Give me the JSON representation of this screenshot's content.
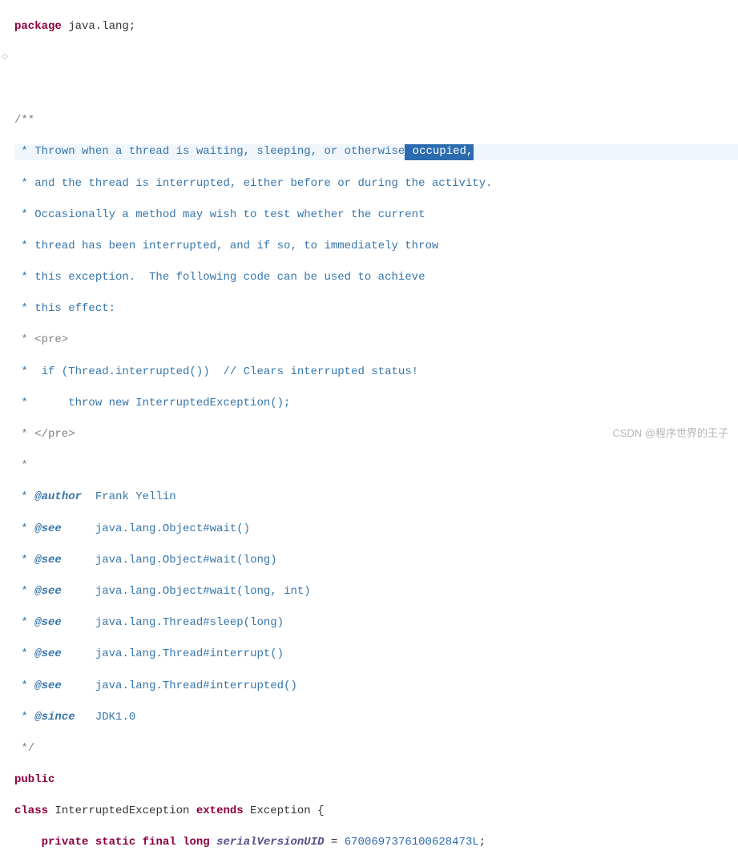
{
  "code": {
    "package_kw": "package",
    "package_name": " java.lang;",
    "doc_open": "/**",
    "doc_line1_prefix": " * Thrown when a thread is waiting, sleeping, or otherwise",
    "doc_line1_sel": " occupied,",
    "doc_line2": " * and the thread is interrupted, either before or during the activity.",
    "doc_line3": " * Occasionally a method may wish to test whether the current",
    "doc_line4": " * thread has been interrupted, and if so, to immediately throw",
    "doc_line5": " * this exception.  The following code can be used to achieve",
    "doc_line6": " * this effect:",
    "doc_line7": " * <pre>",
    "doc_line8": " *  if (Thread.interrupted())  // Clears interrupted status!",
    "doc_line9": " *      throw new InterruptedException();",
    "doc_line10": " * </pre>",
    "doc_line11": " *",
    "tag_author": "@author",
    "author_val": "  Frank Yellin",
    "tag_see": "@see",
    "see1": "     java.lang.Object#wait()",
    "see2": "     java.lang.Object#wait(long)",
    "see3": "     java.lang.Object#wait(long, int)",
    "see4": "     java.lang.Thread#sleep(long)",
    "see5": "     java.lang.Thread#interrupt()",
    "see6": "     java.lang.Thread#interrupted()",
    "tag_since": "@since",
    "since_val": "   JDK1.0",
    "doc_close": " */",
    "kw_public": "public",
    "kw_class": "class",
    "class_name": " InterruptedException ",
    "kw_extends": "extends",
    "extends_name": " Exception {",
    "kw_private": "private",
    "kw_static": "static",
    "kw_final": "final",
    "kw_long": "long",
    "field_name": "serialVersionUID",
    "eq": " = ",
    "field_val": "6700697376100628473L",
    "semi": ";"
  },
  "watermark": "CSDN @程序世界的王子",
  "gutter_marker": "◇"
}
